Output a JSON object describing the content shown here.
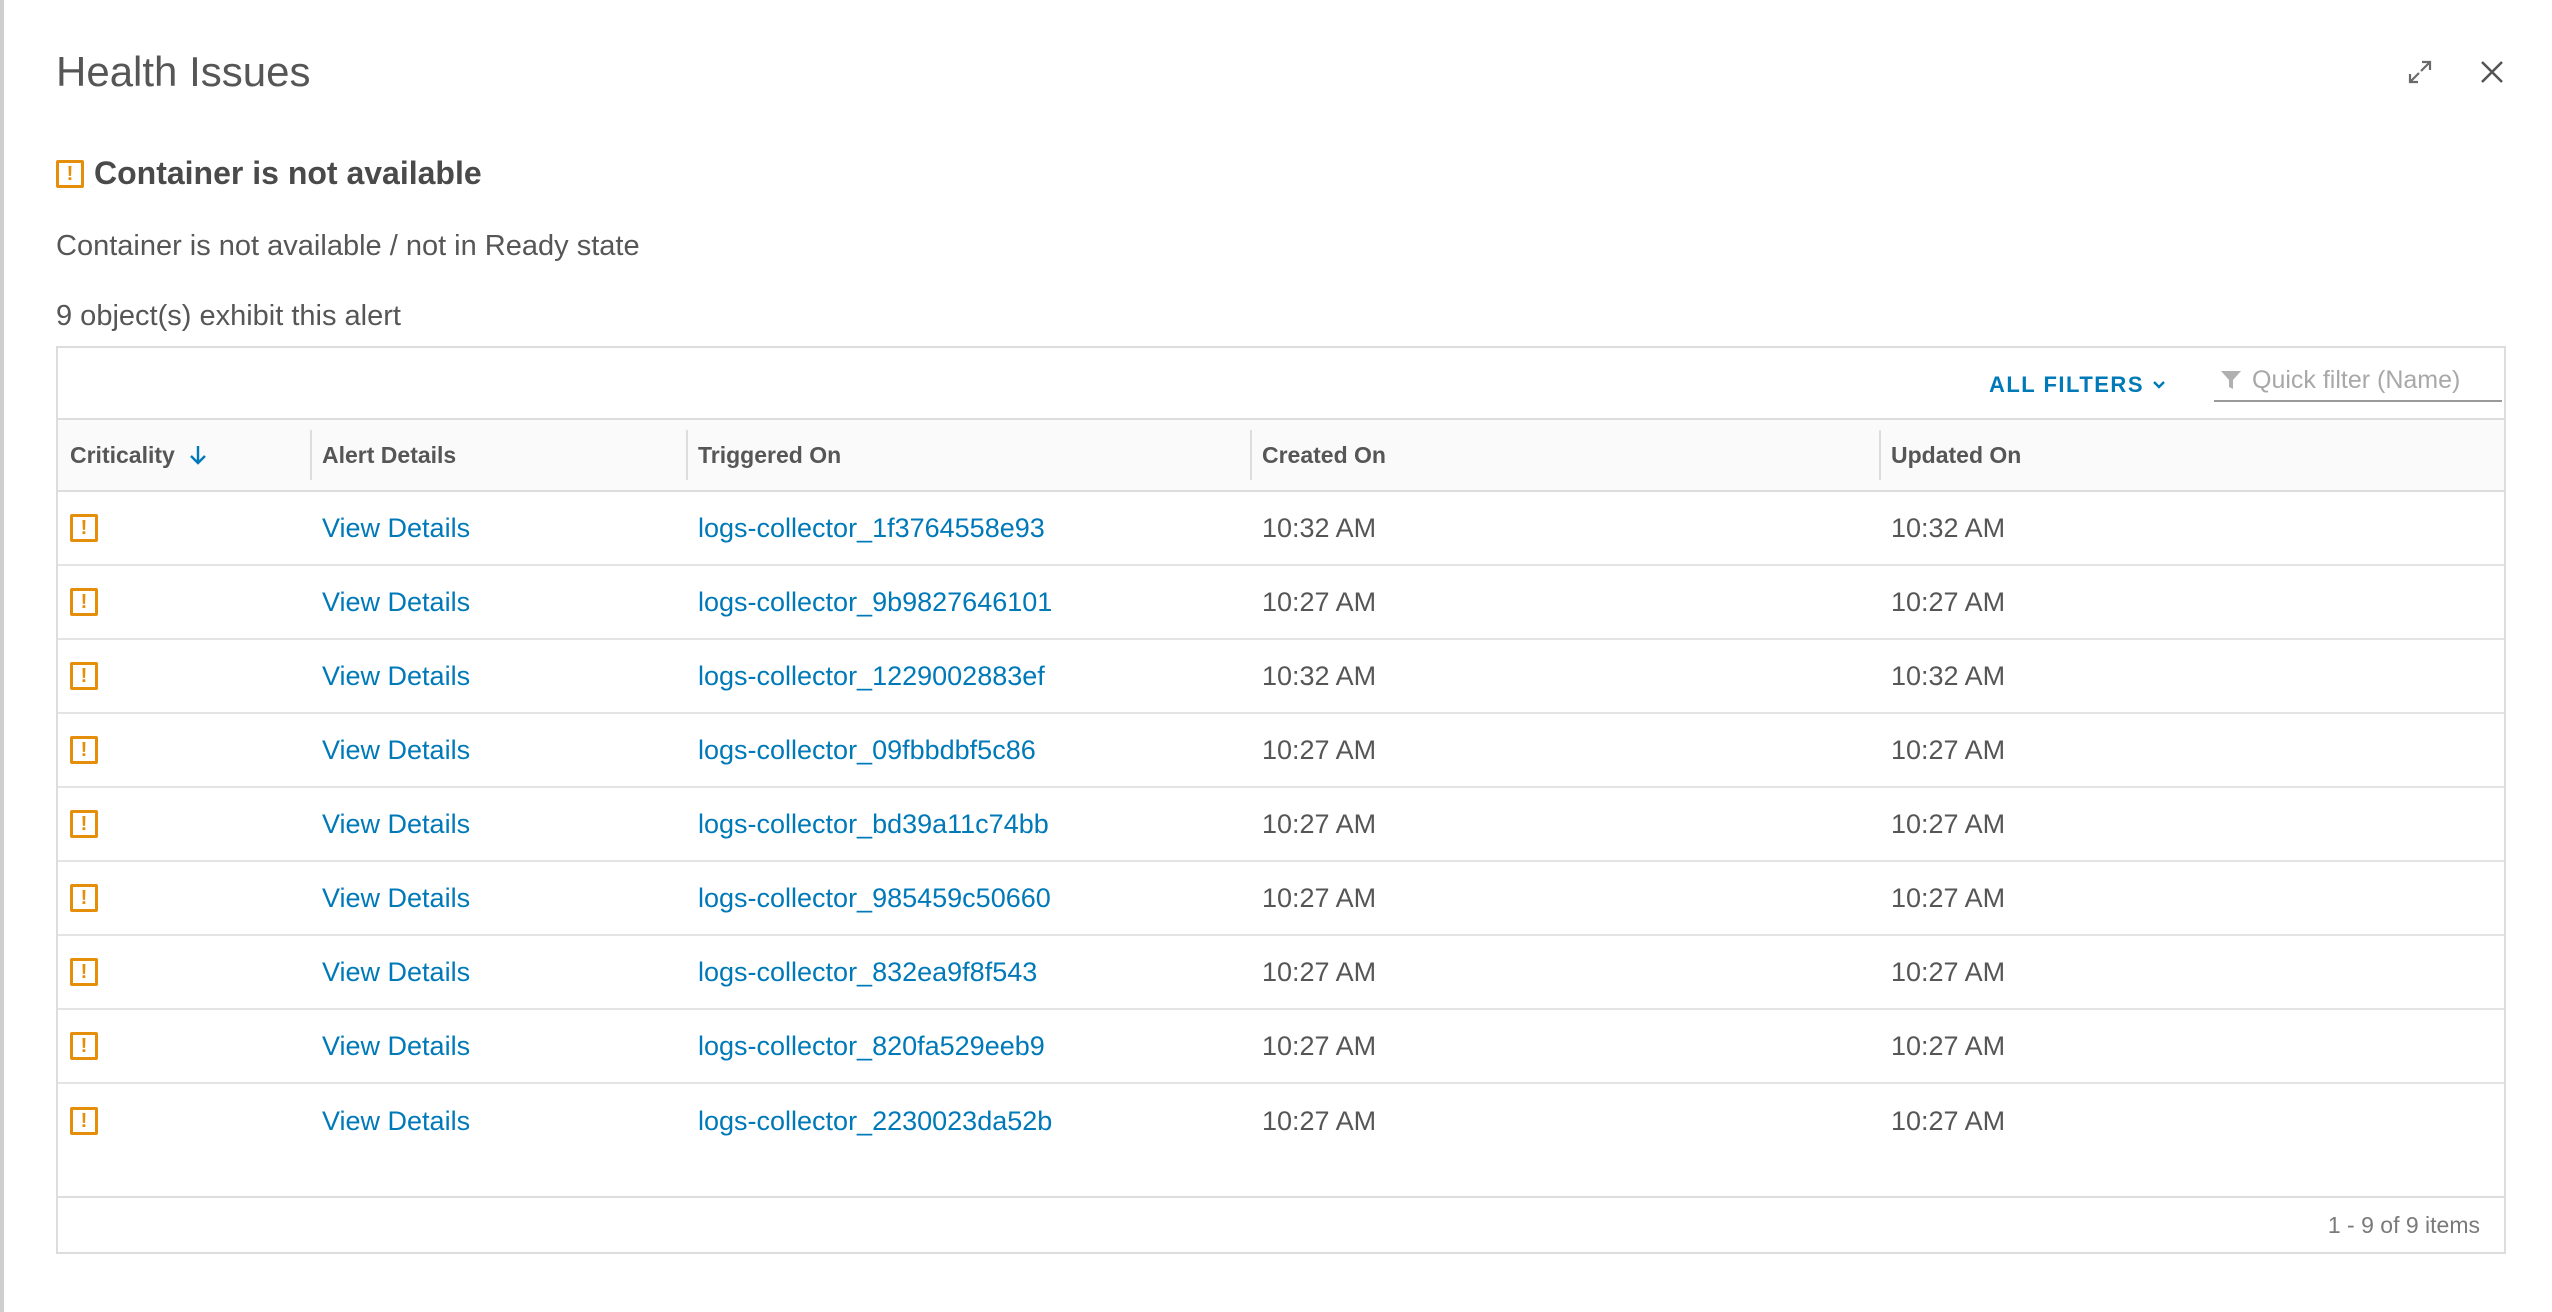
{
  "dialog": {
    "title": "Health Issues",
    "expand_icon": "expand-icon",
    "close_icon": "close-icon"
  },
  "alert": {
    "title": "Container is not available",
    "description": "Container is not available / not in Ready state",
    "count_text": "9 object(s) exhibit this alert",
    "icon": "warning-icon",
    "warning_color": "#e58e0a"
  },
  "toolbar": {
    "all_filters_label": "ALL FILTERS",
    "quick_filter_placeholder": "Quick filter (Name)"
  },
  "table": {
    "columns": [
      "Criticality",
      "Alert Details",
      "Triggered On",
      "Created On",
      "Updated On"
    ],
    "sort_column": "Criticality",
    "sort_direction": "descending",
    "rows": [
      {
        "details": "View Details",
        "triggered": "logs-collector_1f3764558e93",
        "created": "10:32 AM",
        "updated": "10:32 AM"
      },
      {
        "details": "View Details",
        "triggered": "logs-collector_9b9827646101",
        "created": "10:27 AM",
        "updated": "10:27 AM"
      },
      {
        "details": "View Details",
        "triggered": "logs-collector_1229002883ef",
        "created": "10:32 AM",
        "updated": "10:32 AM"
      },
      {
        "details": "View Details",
        "triggered": "logs-collector_09fbbdbf5c86",
        "created": "10:27 AM",
        "updated": "10:27 AM"
      },
      {
        "details": "View Details",
        "triggered": "logs-collector_bd39a11c74bb",
        "created": "10:27 AM",
        "updated": "10:27 AM"
      },
      {
        "details": "View Details",
        "triggered": "logs-collector_985459c50660",
        "created": "10:27 AM",
        "updated": "10:27 AM"
      },
      {
        "details": "View Details",
        "triggered": "logs-collector_832ea9f8f543",
        "created": "10:27 AM",
        "updated": "10:27 AM"
      },
      {
        "details": "View Details",
        "triggered": "logs-collector_820fa529eeb9",
        "created": "10:27 AM",
        "updated": "10:27 AM"
      },
      {
        "details": "View Details",
        "triggered": "logs-collector_2230023da52b",
        "created": "10:27 AM",
        "updated": "10:27 AM"
      }
    ],
    "footer": "1 - 9 of 9 items"
  },
  "colors": {
    "link": "#0079b8",
    "warning": "#e58e0a"
  }
}
